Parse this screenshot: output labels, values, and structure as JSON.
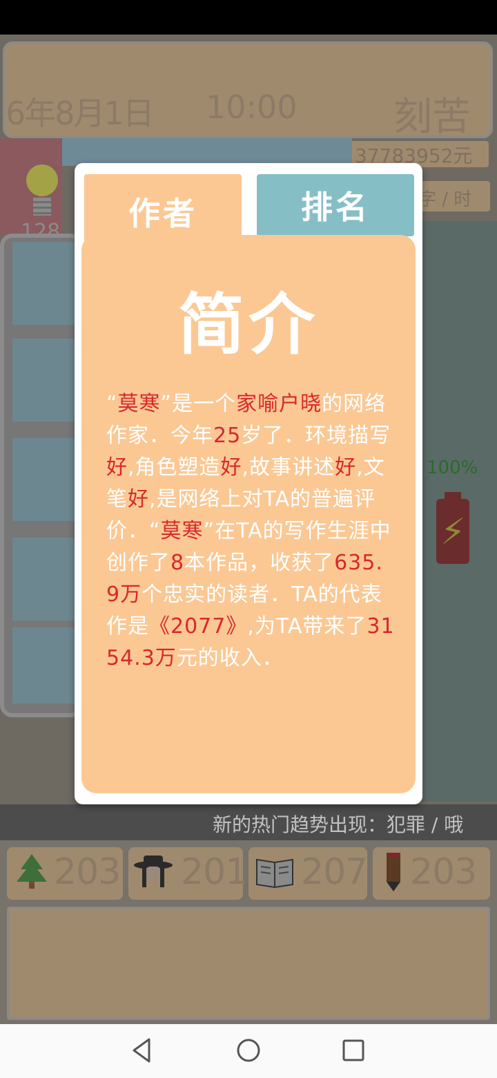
{
  "header": {
    "date": "6年8月1日",
    "time": "10:00",
    "status": "刻苦",
    "money": "37783952元",
    "speed": "字 / 时"
  },
  "idea": {
    "count": "128"
  },
  "energy": {
    "percent": "100%"
  },
  "news": {
    "text": "新的热门趋势出现：犯罪 / 哦"
  },
  "stats": [
    {
      "icon": "tree-icon",
      "value": "203"
    },
    {
      "icon": "character-icon",
      "value": "201"
    },
    {
      "icon": "book-icon",
      "value": "207"
    },
    {
      "icon": "pencil-icon",
      "value": "203"
    }
  ],
  "modal": {
    "tabs": [
      {
        "label": "作者",
        "active": true
      },
      {
        "label": "排名",
        "active": false
      }
    ],
    "title": "简介",
    "intro": [
      {
        "t": "“"
      },
      {
        "t": "莫寒",
        "hl": true
      },
      {
        "t": "”是一个"
      },
      {
        "t": "家喻户晓",
        "hl": true
      },
      {
        "t": "的网络作家．今年"
      },
      {
        "t": "25",
        "hl": true
      },
      {
        "t": "岁了．环境描写"
      },
      {
        "t": "好",
        "hl": true
      },
      {
        "t": ",角色塑造"
      },
      {
        "t": "好",
        "hl": true
      },
      {
        "t": ",故事讲述"
      },
      {
        "t": "好",
        "hl": true
      },
      {
        "t": ",文笔"
      },
      {
        "t": "好",
        "hl": true
      },
      {
        "t": ",是网络上对TA的普遍评价．“"
      },
      {
        "t": "莫寒",
        "hl": true
      },
      {
        "t": "”在TA的写作生涯中创作了"
      },
      {
        "t": "8",
        "hl": true
      },
      {
        "t": "本作品，收获了"
      },
      {
        "t": "635.9万",
        "hl": true
      },
      {
        "t": "个忠实的读者．TA的代表作是"
      },
      {
        "t": "《2077》",
        "hl": true
      },
      {
        "t": ",为TA带来了"
      },
      {
        "t": "3154.3万",
        "hl": true
      },
      {
        "t": "元的收入．"
      }
    ]
  },
  "colors": {
    "card": "#fbc894",
    "rank_tab": "#86bec6",
    "highlight": "#d7282d"
  }
}
